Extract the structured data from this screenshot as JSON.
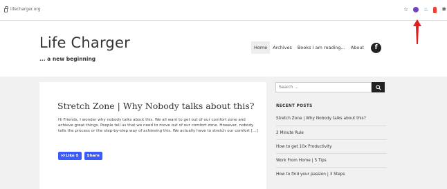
{
  "browser": {
    "url": "lifecharger.org",
    "icons": [
      "star-icon",
      "purple-extension-icon",
      "cup-extension-icon",
      "bottle-extension-icon",
      "puzzle-icon",
      "menu-icon"
    ]
  },
  "site": {
    "title": "Life Charger",
    "tagline": "... a new beginning"
  },
  "nav": {
    "items": [
      "Home",
      "Archives",
      "Books I am reading...",
      "About"
    ],
    "active": "Home",
    "facebook_glyph": "f"
  },
  "post": {
    "title": "Stretch Zone | Why Nobody talks about this?",
    "excerpt": "Hi Friends, I wonder why nobody talks about this. We all want to get out of our comfort zone and achieve great things. People tell us that we need to move out of our comfort zone. However, nobody tells the process or the step-by-step way of achieving this. We actually have to stretch our comfort […]",
    "like_label": "Like 5",
    "share_label": "Share"
  },
  "sidebar": {
    "search_placeholder": "Search ...",
    "recent_posts_title": "RECENT POSTS",
    "recent_posts": [
      "Stretch Zone | Why Nobody talks about this?",
      "2 Minute Rule",
      "How to get 10x Productivity",
      "Work From Home | 5 Tips",
      "How to find your passion | 3 Steps"
    ]
  },
  "colors": {
    "annotation_arrow": "#e02020",
    "button_blue": "#3d5afe",
    "content_bg": "#f1f1f1"
  }
}
